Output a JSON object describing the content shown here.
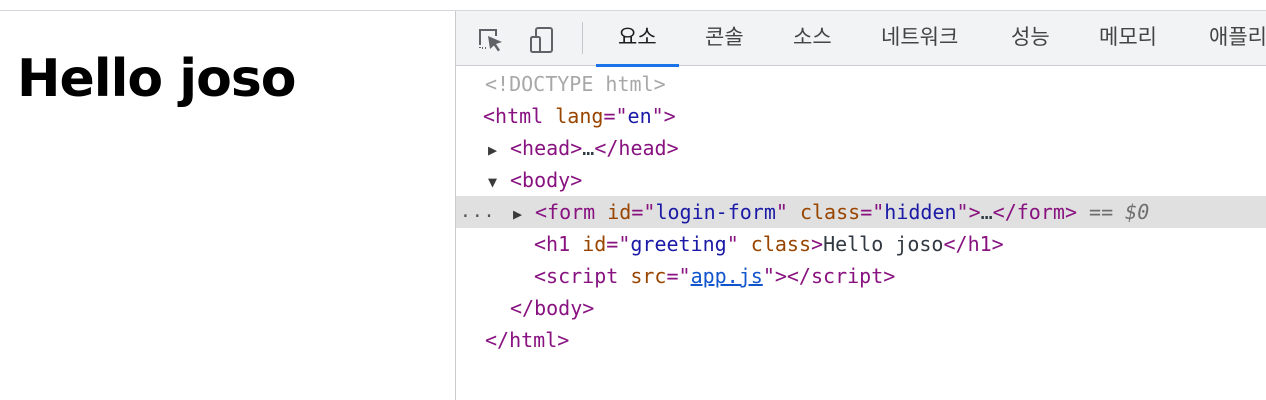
{
  "page": {
    "heading": "Hello joso"
  },
  "devtools": {
    "toolbar": {
      "inspect_icon": "inspect-element-icon",
      "device_icon": "device-toolbar-icon",
      "tabs": [
        {
          "label": "요소",
          "active": true
        },
        {
          "label": "콘솔"
        },
        {
          "label": "소스"
        },
        {
          "label": "네트워크"
        },
        {
          "label": "성능"
        },
        {
          "label": "메모리"
        },
        {
          "label": "애플리"
        }
      ]
    },
    "tree": {
      "doctype": "<!DOCTYPE html>",
      "html_open": {
        "tag": "html",
        "attr": "lang",
        "value": "en"
      },
      "head": {
        "tag": "head",
        "ellipsis": "…"
      },
      "body": {
        "tag": "body"
      },
      "form": {
        "tag": "form",
        "id_attr": "id",
        "id_value": "login-form",
        "class_attr": "class",
        "class_value": "hidden",
        "ellipsis": "…",
        "eq": "==",
        "ref": "$0"
      },
      "h1": {
        "tag": "h1",
        "id_attr": "id",
        "id_value": "greeting",
        "class_attr": "class",
        "text": "Hello joso"
      },
      "script": {
        "tag": "script",
        "src_attr": "src",
        "src_value": "app.js"
      },
      "body_close": "body",
      "html_close": "html",
      "row_dots": "..."
    }
  },
  "colors": {
    "active_tab_underline": "#1a73e8",
    "selected_row": "#e0e0e0",
    "tag": "#881280",
    "attr_name": "#994500",
    "attr_value": "#1a1aa6"
  }
}
